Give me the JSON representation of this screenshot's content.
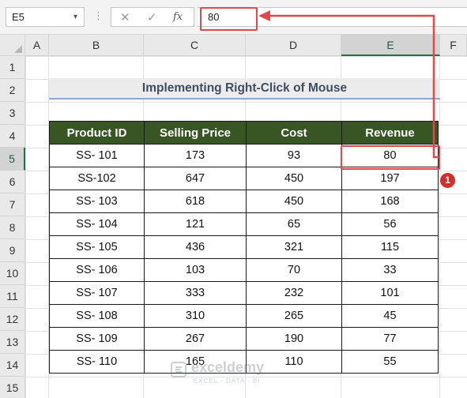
{
  "formula_bar": {
    "name_box": "E5",
    "name_box_caret": "▾",
    "separator": "⋮",
    "cancel_icon": "✕",
    "enter_icon": "✓",
    "fx_label": "fx",
    "formula_value": "80"
  },
  "columns": [
    "A",
    "B",
    "C",
    "D",
    "E",
    "F"
  ],
  "rows": [
    "1",
    "2",
    "3",
    "4",
    "5",
    "6",
    "7",
    "8",
    "9",
    "10",
    "11",
    "12",
    "13",
    "14",
    "15"
  ],
  "selected": {
    "column": "E",
    "row": "5"
  },
  "sheet": {
    "title": "Implementing Right-Click of Mouse",
    "headers": [
      "Product ID",
      "Selling Price",
      "Cost",
      "Revenue"
    ],
    "data": [
      [
        "SS- 101",
        "173",
        "93",
        "80"
      ],
      [
        "SS-102",
        "647",
        "450",
        "197"
      ],
      [
        "SS- 103",
        "618",
        "450",
        "168"
      ],
      [
        "SS- 104",
        "121",
        "65",
        "56"
      ],
      [
        "SS- 105",
        "436",
        "321",
        "115"
      ],
      [
        "SS- 106",
        "103",
        "70",
        "33"
      ],
      [
        "SS- 107",
        "333",
        "232",
        "101"
      ],
      [
        "SS- 108",
        "310",
        "265",
        "45"
      ],
      [
        "SS- 109",
        "267",
        "190",
        "77"
      ],
      [
        "SS- 110",
        "165",
        "110",
        "55"
      ]
    ]
  },
  "annotation": {
    "step": "1",
    "color": "#e0484b"
  },
  "watermark": {
    "name": "exceldemy",
    "tagline": "EXCEL · DATA · BI"
  },
  "colors": {
    "header_fill": "#375623",
    "accent": "#217346",
    "title_text": "#3f4d63"
  }
}
